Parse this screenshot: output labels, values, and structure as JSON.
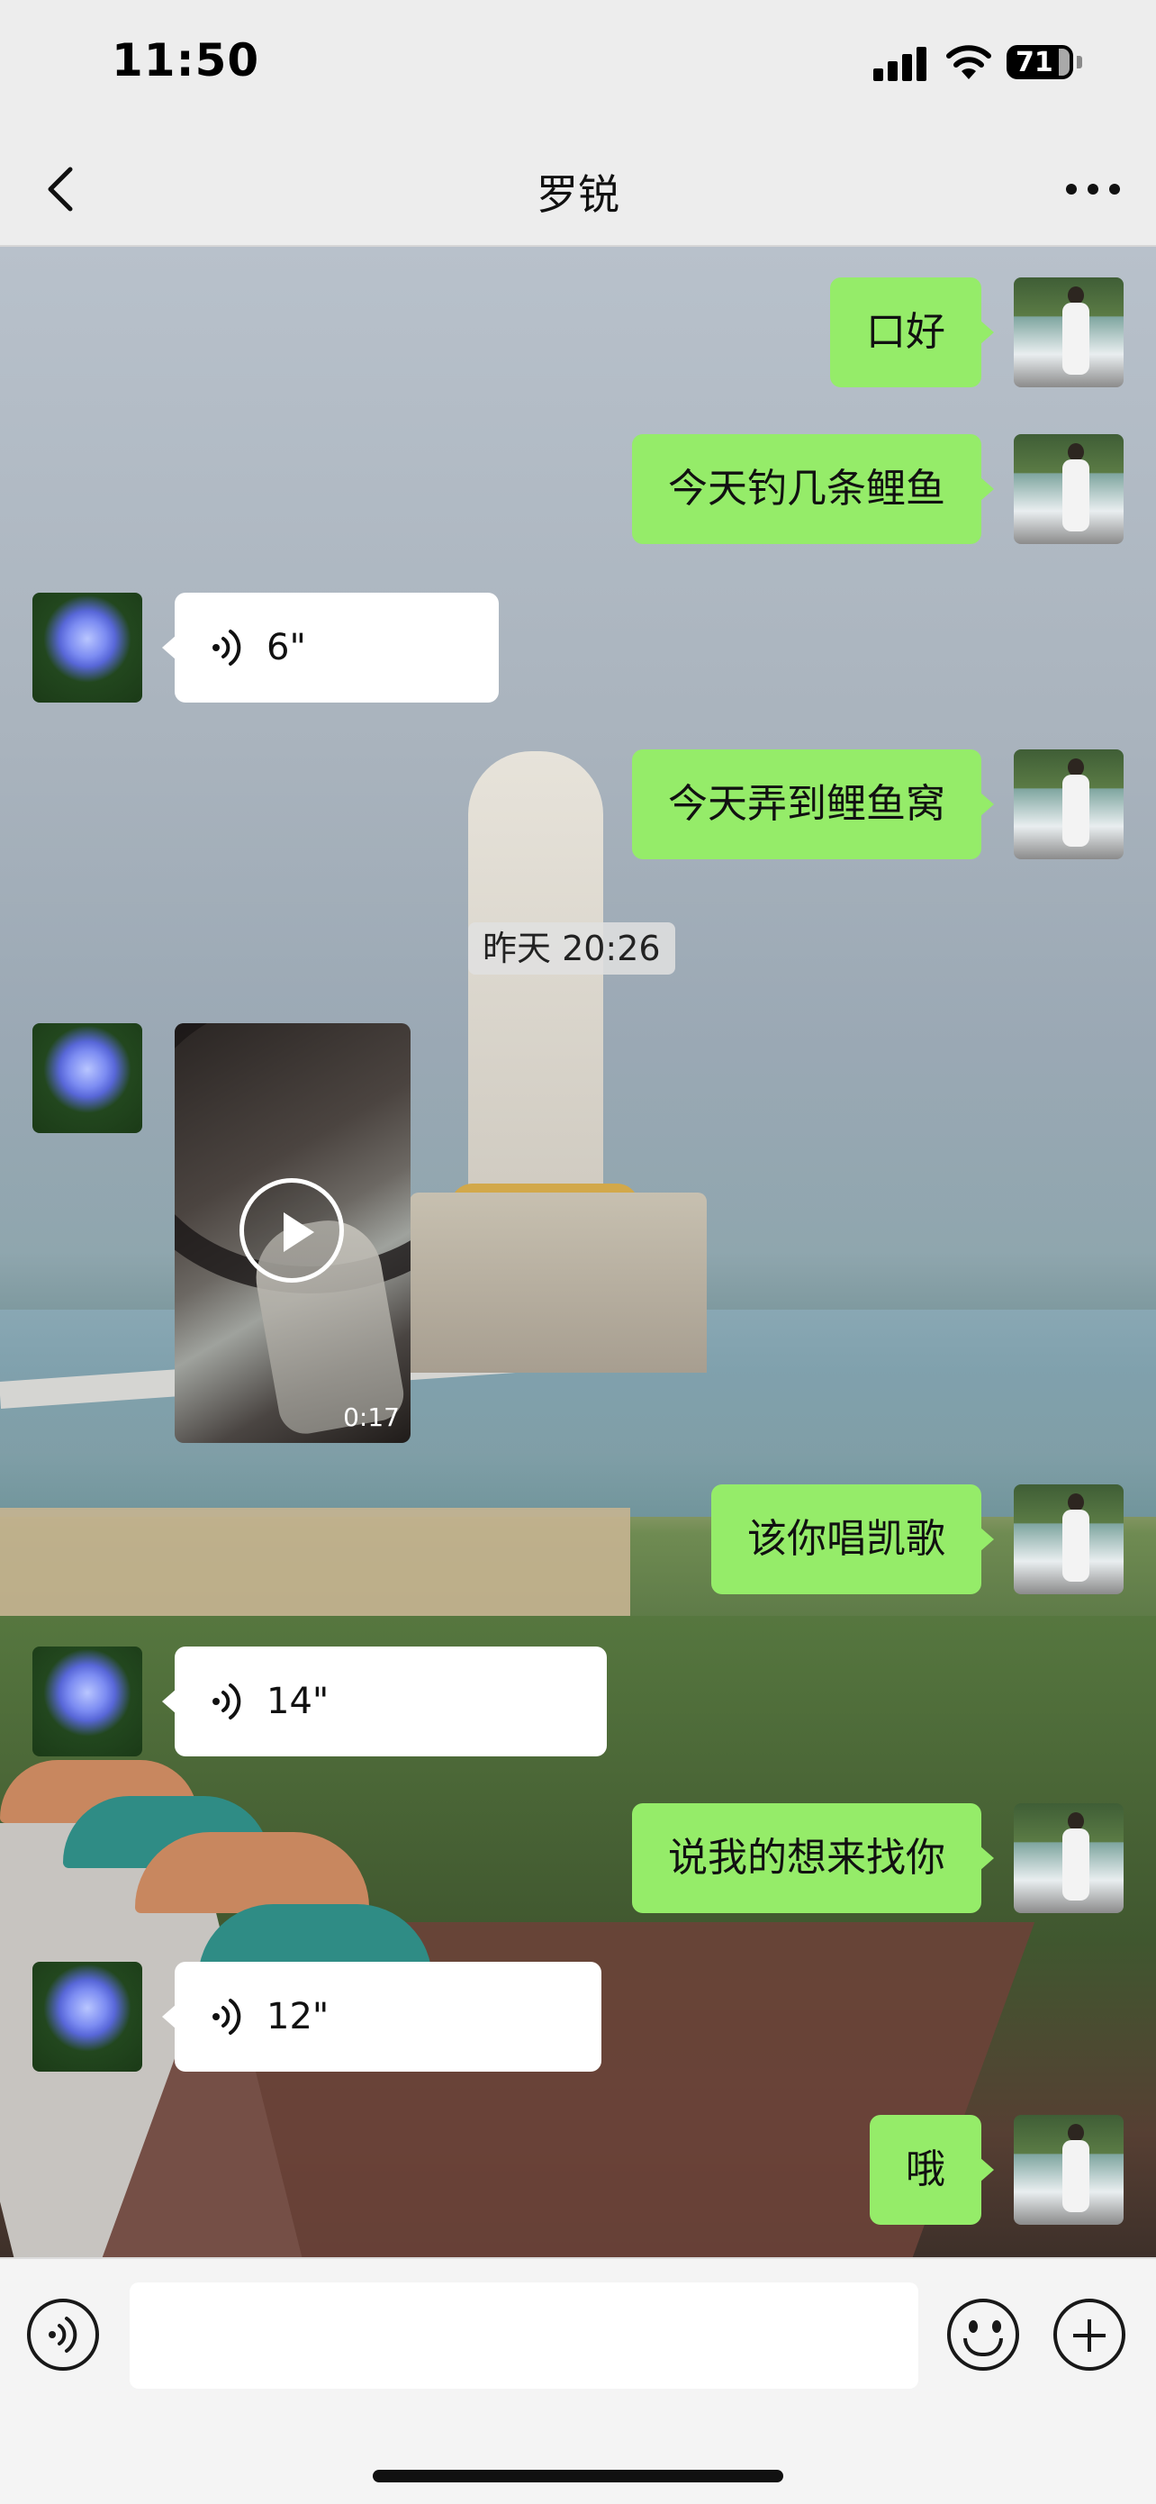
{
  "status_bar": {
    "time": "11:50",
    "battery": "71"
  },
  "header": {
    "title": "罗锐"
  },
  "chat": {
    "messages": [
      {
        "side": "me",
        "type": "text",
        "text": "口好"
      },
      {
        "side": "me",
        "type": "text",
        "text": "今天钓几条鲤鱼"
      },
      {
        "side": "them",
        "type": "voice",
        "duration": "6\""
      },
      {
        "side": "me",
        "type": "text",
        "text": "今天弄到鲤鱼窝"
      },
      {
        "type": "timestamp",
        "text": "昨天 20:26"
      },
      {
        "side": "them",
        "type": "video",
        "duration": "0:17"
      },
      {
        "side": "me",
        "type": "text",
        "text": "该你唱凯歌"
      },
      {
        "side": "them",
        "type": "voice",
        "duration": "14\""
      },
      {
        "side": "me",
        "type": "text",
        "text": "说我的想来找你"
      },
      {
        "side": "them",
        "type": "voice",
        "duration": "12\""
      },
      {
        "side": "me",
        "type": "text",
        "text": "哦"
      }
    ]
  },
  "input": {
    "value": "",
    "placeholder": ""
  },
  "icons": {
    "back": "chevron-left-icon",
    "more": "ellipsis-icon",
    "voice_toggle": "voice-icon",
    "emoji": "emoji-icon",
    "plus": "plus-icon"
  },
  "colors": {
    "my_bubble": "#95ec69",
    "their_bubble": "#ffffff",
    "bar_background": "#ededed"
  }
}
